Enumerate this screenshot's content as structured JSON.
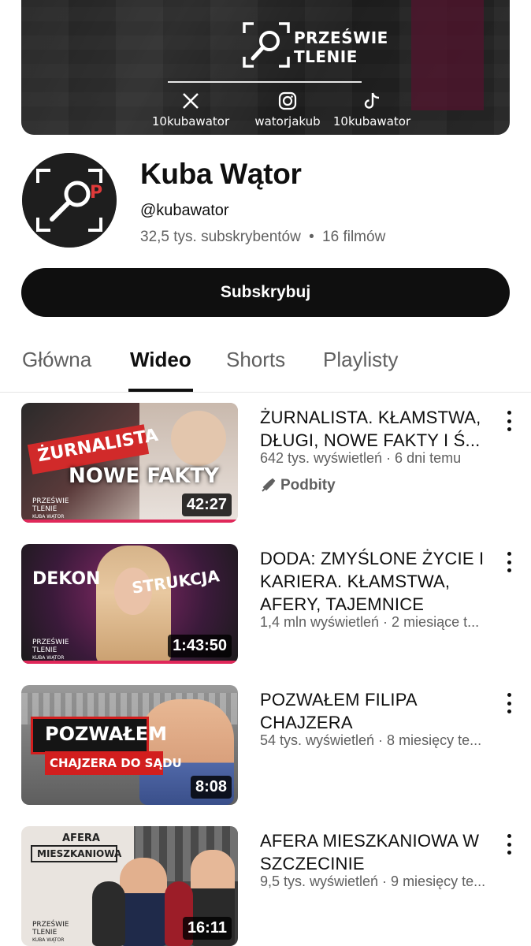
{
  "banner": {
    "brand_line1": "PRZEŚWIE",
    "brand_line2": "TLENIE",
    "socials": [
      {
        "icon": "x-icon",
        "handle": "10kubawator"
      },
      {
        "icon": "instagram-icon",
        "handle": "watorjakub"
      },
      {
        "icon": "tiktok-icon",
        "handle": "10kubawator"
      }
    ]
  },
  "channel": {
    "name": "Kuba Wątor",
    "handle": "@kubawator",
    "subscribers": "32,5 tys. subskrybentów",
    "separator": "•",
    "videos_count": "16 filmów",
    "subscribe_label": "Subskrybuj"
  },
  "tabs": [
    {
      "label": "Główna",
      "active": false
    },
    {
      "label": "Wideo",
      "active": true
    },
    {
      "label": "Shorts",
      "active": false
    },
    {
      "label": "Playlisty",
      "active": false
    }
  ],
  "videos": [
    {
      "title": "ŻURNALISTA. KŁAMSTWA, DŁUGI, NOWE FAKTY I Ś...",
      "meta": "642 tys. wyświetleń · 6 dni temu",
      "badge": "Podbity",
      "duration": "42:27",
      "thumb_text": [
        "ŻURNALISTA",
        "NOWE FAKTY"
      ],
      "thumb_brand": "PRZEŚWIE TLENIE",
      "thumb_author": "KUBA WĄTOR"
    },
    {
      "title": "DODA: ZMYŚLONE ŻYCIE I KARIERA. KŁAMSTWA, AFERY, TAJEMNICE",
      "meta": "1,4 mln wyświetleń · 2 miesiące t...",
      "duration": "1:43:50",
      "thumb_text": [
        "DEKON",
        "STRUKCJA"
      ],
      "thumb_brand": "PRZEŚWIE TLENIE",
      "thumb_author": "KUBA WĄTOR"
    },
    {
      "title": "POZWAŁEM FILIPA CHAJZERA",
      "meta": "54 tys. wyświetleń · 8 miesięcy te...",
      "duration": "8:08",
      "thumb_text": [
        "POZWAŁEM",
        "CHAJZERA DO SĄDU"
      ]
    },
    {
      "title": "AFERA MIESZKANIOWA W SZCZECINIE",
      "meta": "9,5 tys. wyświetleń · 9 miesięcy te...",
      "duration": "16:11",
      "thumb_text": [
        "AFERA",
        "MIESZKANIOWA"
      ],
      "thumb_brand": "PRZEŚWIE TLENIE",
      "thumb_author": "KUBA WĄTOR"
    }
  ]
}
